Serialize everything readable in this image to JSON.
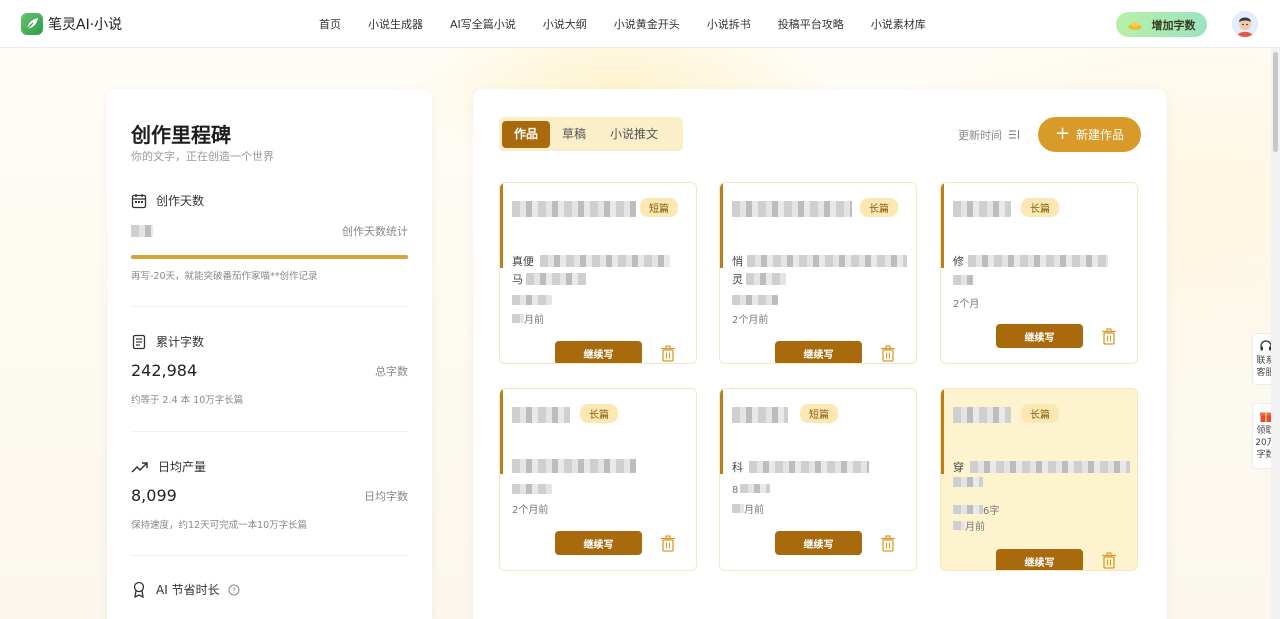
{
  "header": {
    "brand": "笔灵AI·小说",
    "nav": [
      "首页",
      "小说生成器",
      "AI写全篇小说",
      "小说大纲",
      "小说黄金开头",
      "小说拆书",
      "投稿平台攻略",
      "小说素材库"
    ],
    "add_words": "增加字数"
  },
  "milestones": {
    "title": "创作里程碑",
    "subtitle": "你的文字，正在创造一个世界",
    "days": {
      "label": "创作天数",
      "right_label": "创作天数统计",
      "note": "再写-20天，就能突破番茄作家喵**创作记录",
      "progress": 1.0
    },
    "total_words": {
      "label": "累计字数",
      "value": "242,984",
      "right_label": "总字数",
      "note": "约等于 2.4 本 10万字长篇"
    },
    "daily": {
      "label": "日均产量",
      "value": "8,099",
      "right_label": "日均字数",
      "note": "保持速度，约12天可完成一本10万字长篇"
    },
    "ai_time": {
      "label": "AI 节省时长"
    }
  },
  "works": {
    "tabs": [
      "作品",
      "草稿",
      "小说推文"
    ],
    "active_tab": "作品",
    "sort_label": "更新时间",
    "new_button": "新建作品",
    "continue_label": "继续写",
    "cards": [
      {
        "tag": "短篇",
        "line1": "真便",
        "line2": "马",
        "words": "",
        "time": "月前"
      },
      {
        "tag": "长篇",
        "line1": "悄",
        "line2": "灵",
        "words": "",
        "time": "2个月前"
      },
      {
        "tag": "长篇",
        "line1": "修",
        "line2": "",
        "words": "",
        "time": "2个月"
      },
      {
        "tag": "长篇",
        "line1": "",
        "line2": "",
        "words": "",
        "time": "2个月前"
      },
      {
        "tag": "短篇",
        "line1": "科",
        "line2": "",
        "words": "8",
        "time": "月前"
      },
      {
        "tag": "长篇",
        "line1": "穿",
        "line2": "",
        "words": "6字",
        "time": "月前"
      }
    ]
  },
  "side": {
    "service": [
      "联系",
      "客服"
    ],
    "gift": [
      "领取",
      "20万",
      "字数"
    ]
  },
  "colors": {
    "accent": "#a86a0c",
    "gold": "#d89b2a",
    "tag_bg": "#fbe8b3"
  }
}
